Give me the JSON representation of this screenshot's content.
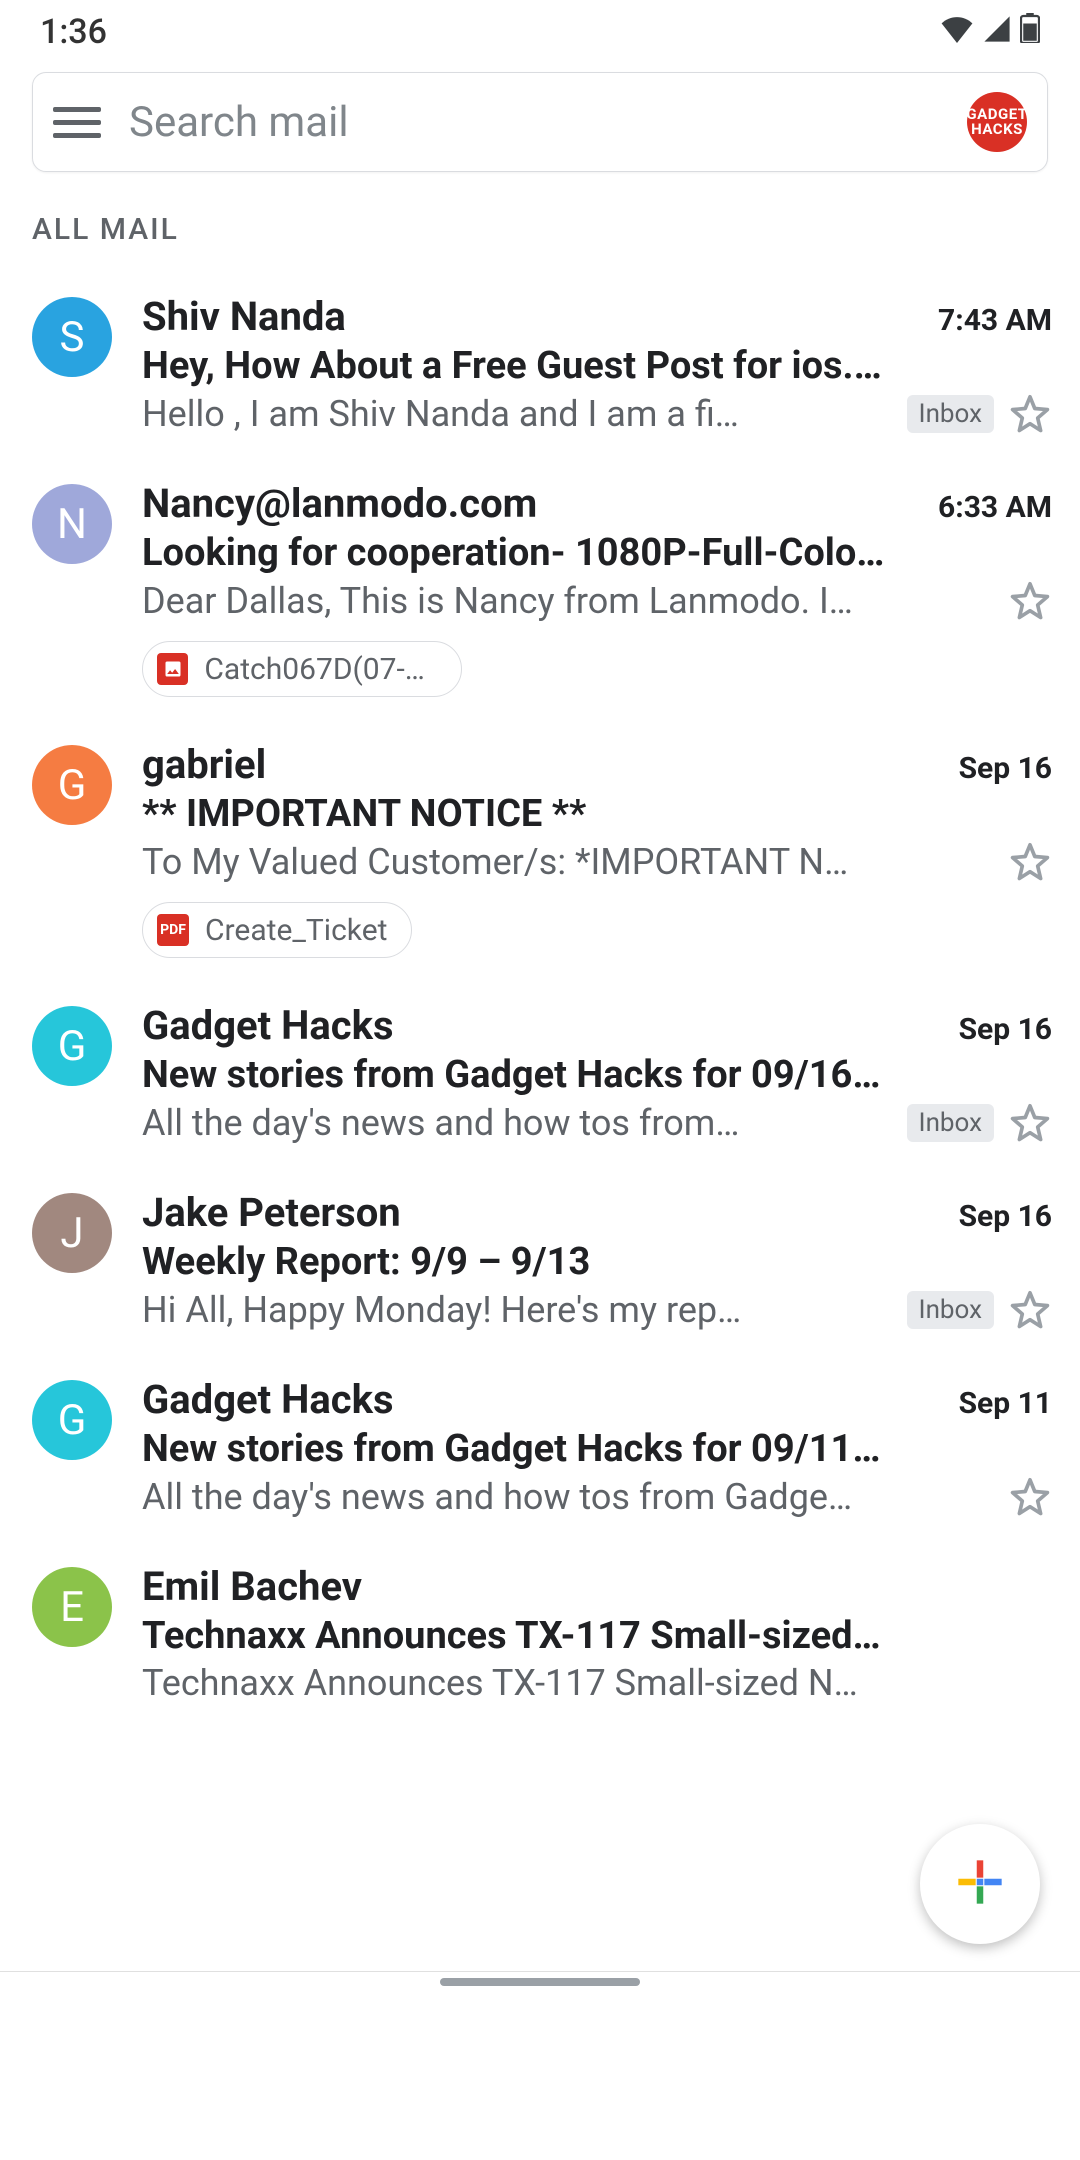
{
  "status": {
    "time": "1:36"
  },
  "search": {
    "placeholder": "Search mail",
    "account_label": "GADGET\nHACKS"
  },
  "section_label": "ALL MAIL",
  "labels": {
    "inbox": "Inbox"
  },
  "emails": [
    {
      "sender": "Shiv Nanda",
      "time": "7:43 AM",
      "subject": "Hey, How About a Free Guest Post for ios.…",
      "snippet": "Hello , I am Shiv Nanda and I am a fi…",
      "avatar_letter": "S",
      "avatar_color": "#29a3e0",
      "label": "Inbox",
      "starred": false,
      "attachment": null
    },
    {
      "sender": "Nancy@lanmodo.com",
      "time": "6:33 AM",
      "subject": "Looking for cooperation- 1080P-Full-Colo…",
      "snippet": "Dear Dallas, This is Nancy from Lanmodo. I…",
      "avatar_letter": "N",
      "avatar_color": "#9fa8da",
      "label": null,
      "starred": false,
      "attachment": {
        "type": "image",
        "name": "Catch067D(07-0…"
      }
    },
    {
      "sender": "gabriel",
      "time": "Sep 16",
      "subject": "** IMPORTANT NOTICE **",
      "snippet": "To My Valued Customer/s: *IMPORTANT N…",
      "avatar_letter": "G",
      "avatar_color": "#f57c42",
      "label": null,
      "starred": false,
      "attachment": {
        "type": "pdf",
        "name": "Create_Ticket"
      }
    },
    {
      "sender": "Gadget Hacks",
      "time": "Sep 16",
      "subject": "New stories from Gadget Hacks for 09/16…",
      "snippet": "All the day's news and how tos from…",
      "avatar_letter": "G",
      "avatar_color": "#26c6da",
      "label": "Inbox",
      "starred": false,
      "attachment": null
    },
    {
      "sender": "Jake Peterson",
      "time": "Sep 16",
      "subject": "Weekly Report: 9/9 – 9/13",
      "snippet": "Hi All, Happy Monday! Here's my rep…",
      "avatar_letter": "J",
      "avatar_color": "#a1887f",
      "label": "Inbox",
      "starred": false,
      "attachment": null
    },
    {
      "sender": "Gadget Hacks",
      "time": "Sep 11",
      "subject": "New stories from Gadget Hacks for 09/11…",
      "snippet": "All the day's news and how tos from Gadge…",
      "avatar_letter": "G",
      "avatar_color": "#26c6da",
      "label": null,
      "starred": false,
      "attachment": null
    },
    {
      "sender": "Emil Bachev",
      "time": "",
      "subject": "Technaxx Announces TX-117 Small-sized…",
      "snippet": "Technaxx Announces TX-117 Small-sized N…",
      "avatar_letter": "E",
      "avatar_color": "#8bc34a",
      "label": null,
      "starred": false,
      "attachment": null
    }
  ]
}
